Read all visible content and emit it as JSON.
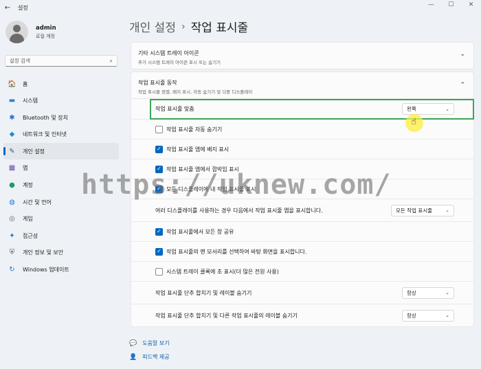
{
  "window": {
    "title": "설정",
    "back": "←",
    "min": "—",
    "max": "☐",
    "close": "✕"
  },
  "profile": {
    "name": "admin",
    "subtitle": "로컬 계정"
  },
  "search": {
    "placeholder": "설정 검색",
    "icon": "⌕"
  },
  "sidebar": {
    "items": [
      {
        "label": "홈",
        "icon": "🏠",
        "icon_name": "home-icon"
      },
      {
        "label": "시스템",
        "icon": "▬",
        "icon_name": "monitor-icon"
      },
      {
        "label": "Bluetooth 및 장치",
        "icon": "✱",
        "icon_name": "bluetooth-icon"
      },
      {
        "label": "네트워크 및 인터넷",
        "icon": "◆",
        "icon_name": "wifi-icon"
      },
      {
        "label": "개인 설정",
        "icon": "✎",
        "icon_name": "brush-icon",
        "active": true
      },
      {
        "label": "앱",
        "icon": "▦",
        "icon_name": "apps-icon"
      },
      {
        "label": "계정",
        "icon": "●",
        "icon_name": "account-icon"
      },
      {
        "label": "시간 및 언어",
        "icon": "◍",
        "icon_name": "globe-clock-icon"
      },
      {
        "label": "게임",
        "icon": "◎",
        "icon_name": "gamepad-icon"
      },
      {
        "label": "접근성",
        "icon": "✦",
        "icon_name": "accessibility-icon"
      },
      {
        "label": "개인 정보 및 보안",
        "icon": "⛨",
        "icon_name": "shield-icon"
      },
      {
        "label": "Windows 업데이트",
        "icon": "↻",
        "icon_name": "update-icon"
      }
    ]
  },
  "breadcrumb": {
    "parent": "개인 설정",
    "sep": "›",
    "current": "작업 표시줄"
  },
  "tray_icons": {
    "title": "기타 시스템 트레이 아이콘",
    "subtitle": "추가 시스템 트레이 아이콘 표시 또는 숨기기",
    "chevron": "⌄"
  },
  "behaviors": {
    "title": "작업 표시줄 동작",
    "subtitle": "작업 표시줄 정렬, 배지 표시, 자동 숨기기 및 다중 디스플레이",
    "chevron": "⌃",
    "alignment": {
      "label": "작업 표시줄 맞춤",
      "value": "왼쪽"
    },
    "auto_hide": {
      "label": "작업 표시줄 자동 숨기기",
      "checked": false
    },
    "badges": {
      "label": "작업 표시줄 앱에 배지 표시",
      "checked": true
    },
    "flashing": {
      "label": "작업 표시줄 앱에서 깜박임 표시",
      "checked": true
    },
    "all_displays": {
      "label": "모든 디스플레이에 내 작업 표시줄 표시",
      "checked": true
    },
    "multi_display": {
      "label": "여러 디스플레이를 사용하는 경우 다음에서 작업 표시줄 앱을 표시합니다.",
      "value": "모든 작업 표시줄"
    },
    "share_window": {
      "label": "작업 표시줄에서 모든 창 공유",
      "checked": true
    },
    "far_corner": {
      "label": "작업 표시줄의 맨 모서리를 선택하여 바탕 화면을 표시합니다.",
      "checked": true
    },
    "seconds": {
      "label": "시스템 트레이 클록에 초 표시(더 많은 전원 사용)",
      "checked": false
    },
    "combine": {
      "label": "작업 표시줄 단추 합치기 및 레이블 숨기기",
      "value": "항상"
    },
    "combine_other": {
      "label": "작업 표시줄 단추 합치기 및 다른 작업 표시줄의 레이블 숨기기",
      "value": "항상"
    }
  },
  "footer": {
    "help": "도움말 보기",
    "feedback": "피드백 제공"
  },
  "watermark": "https://uknew.com/",
  "colors": {
    "accent": "#0067c0",
    "highlight_border": "#3aa655",
    "cursor_glow": "#ffee3c"
  }
}
